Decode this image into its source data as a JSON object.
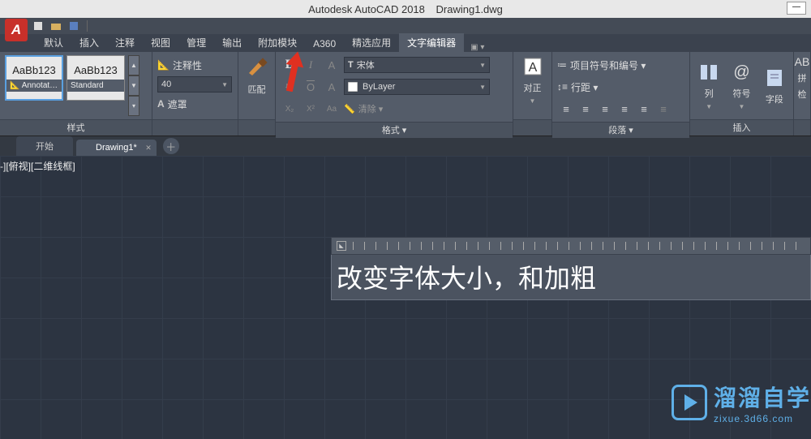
{
  "titlebar": {
    "app": "Autodesk AutoCAD 2018",
    "doc": "Drawing1.dwg"
  },
  "ribbon_tabs": [
    "默认",
    "插入",
    "注释",
    "视图",
    "管理",
    "输出",
    "附加模块",
    "A360",
    "精选应用",
    "文字编辑器"
  ],
  "ribbon_active": 9,
  "panels": {
    "style": {
      "title": "样式",
      "cards": [
        {
          "sample": "AaBb123",
          "name": "Annotat…"
        },
        {
          "sample": "AaBb123",
          "name": "Standard"
        }
      ]
    },
    "annot": {
      "label": "注释性",
      "height": "40",
      "mask": "遮罩"
    },
    "match": {
      "label": "匹配"
    },
    "format": {
      "title": "格式 ▾",
      "font": "宋体",
      "layer": "ByLayer",
      "clear": "清除 ▾",
      "btns": {
        "bold": "B",
        "italic": "I",
        "font_A": "A",
        "strike": "U",
        "overline": "O",
        "otherA": "A",
        "sub": "X₂",
        "sup": "X²",
        "aa": "Aa"
      }
    },
    "align": {
      "title": "对正"
    },
    "para": {
      "title": "段落 ▾",
      "bullets": "项目符号和编号 ▾",
      "spacing": "行距 ▾"
    },
    "insert": {
      "title": "插入",
      "col": "列",
      "sym": "符号",
      "field": "字段"
    },
    "spell": {
      "label1": "拼",
      "label2": "检"
    }
  },
  "doc_tabs": {
    "start": "开始",
    "drawing": "Drawing1*"
  },
  "view_label": "-][俯视][二维线框]",
  "editor_text": "改变字体大小，和加粗",
  "watermark": {
    "big": "溜溜自学",
    "small": "zixue.3d66.com"
  }
}
